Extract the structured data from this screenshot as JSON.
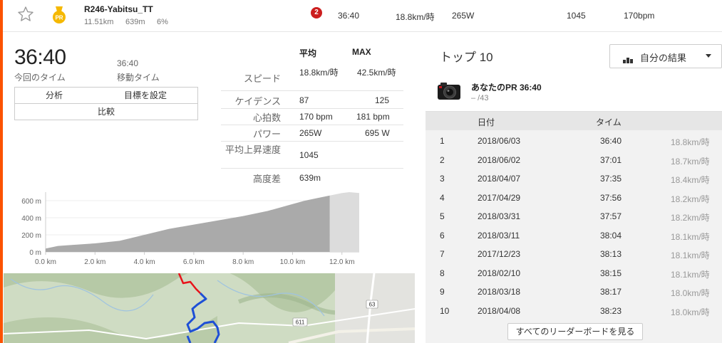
{
  "colors": {
    "accent": "#fc5200",
    "rank_badge": "#cc1e1e",
    "pr_medal": "#f5b800",
    "route_blue": "#1d4fd6",
    "route_red": "#e8131a"
  },
  "segment": {
    "name": "R246-Yabitsu_TT",
    "distance": "11.51km",
    "elev_gain": "639m",
    "grade": "6%",
    "medal_text": "PR",
    "rank": "2",
    "time": "36:40",
    "speed": "18.8km/時",
    "power": "265W",
    "vam": "1045",
    "hr": "170bpm"
  },
  "summary": {
    "elapsed_time": "36:40",
    "elapsed_label": "今回のタイム",
    "moving_time": "36:40",
    "moving_label": "移動タイム",
    "buttons": {
      "analyze": "分析",
      "set_goal": "目標を設定",
      "compare": "比較"
    }
  },
  "stats": {
    "col_avg": "平均",
    "col_max": "MAX",
    "rows": [
      {
        "label": "スピード",
        "avg": "18.8km/時",
        "max": "42.5km/時"
      },
      {
        "label": "ケイデンス",
        "avg": "87",
        "max": "125"
      },
      {
        "label": "心拍数",
        "avg": "170 bpm",
        "max": "181 bpm"
      },
      {
        "label": "パワー",
        "avg": "265W",
        "max": "695 W"
      },
      {
        "label": "平均上昇速度",
        "avg": "1045",
        "max": ""
      },
      {
        "label": "高度差",
        "avg": "639m",
        "max": ""
      }
    ]
  },
  "chart_data": {
    "type": "area",
    "title": "",
    "xlabel": "",
    "ylabel": "",
    "x_ticks": [
      "0.0 km",
      "2.0 km",
      "4.0 km",
      "6.0 km",
      "8.0 km",
      "10.0 km",
      "12.0 km"
    ],
    "y_ticks": [
      "0 m",
      "200 m",
      "400 m",
      "600 m"
    ],
    "xlim": [
      0,
      12.7
    ],
    "ylim": [
      0,
      700
    ],
    "segment_end_km": 11.51,
    "x": [
      0,
      0.5,
      1,
      2,
      3,
      4,
      5,
      6,
      7,
      8,
      9,
      10,
      10.5,
      11,
      11.51,
      12,
      12.3,
      12.7
    ],
    "y": [
      40,
      70,
      80,
      100,
      130,
      200,
      270,
      320,
      370,
      420,
      480,
      560,
      600,
      630,
      660,
      690,
      700,
      690
    ]
  },
  "map": {
    "road_labels": [
      "611",
      "63"
    ]
  },
  "leaderboard": {
    "title": "トップ 10",
    "dropdown_label": "自分の結果",
    "pr_label": "あなたのPR 36:40",
    "pr_rank": "– /43",
    "headers": {
      "date": "日付",
      "time": "タイム"
    },
    "rows": [
      {
        "rank": "1",
        "date": "2018/06/03",
        "time": "36:40",
        "speed": "18.8km/時"
      },
      {
        "rank": "2",
        "date": "2018/06/02",
        "time": "37:01",
        "speed": "18.7km/時"
      },
      {
        "rank": "3",
        "date": "2018/04/07",
        "time": "37:35",
        "speed": "18.4km/時"
      },
      {
        "rank": "4",
        "date": "2017/04/29",
        "time": "37:56",
        "speed": "18.2km/時"
      },
      {
        "rank": "5",
        "date": "2018/03/31",
        "time": "37:57",
        "speed": "18.2km/時"
      },
      {
        "rank": "6",
        "date": "2018/03/11",
        "time": "38:04",
        "speed": "18.1km/時"
      },
      {
        "rank": "7",
        "date": "2017/12/23",
        "time": "38:13",
        "speed": "18.1km/時"
      },
      {
        "rank": "8",
        "date": "2018/02/10",
        "time": "38:15",
        "speed": "18.1km/時"
      },
      {
        "rank": "9",
        "date": "2018/03/18",
        "time": "38:17",
        "speed": "18.0km/時"
      },
      {
        "rank": "10",
        "date": "2018/04/08",
        "time": "38:23",
        "speed": "18.0km/時"
      }
    ],
    "see_all": "すべてのリーダーボードを見る"
  }
}
